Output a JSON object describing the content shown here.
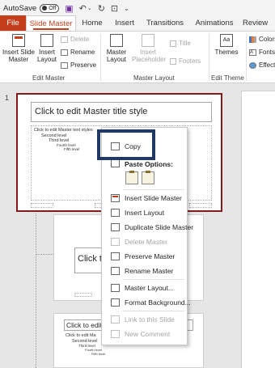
{
  "titlebar": {
    "autosave": "AutoSave",
    "toggle": "Off"
  },
  "tabs": [
    "File",
    "Slide Master",
    "Home",
    "Insert",
    "Transitions",
    "Animations",
    "Review"
  ],
  "ribbon": {
    "insert_slide_master": "Insert Slide Master",
    "insert_layout": "Insert Layout",
    "delete": "Delete",
    "rename": "Rename",
    "preserve": "Preserve",
    "group_edit_master": "Edit Master",
    "master_layout": "Master Layout",
    "insert_placeholder": "Insert Placeholder",
    "title": "Title",
    "footers": "Footers",
    "group_master_layout": "Master Layout",
    "themes": "Themes",
    "group_edit_theme": "Edit Theme",
    "colors": "Colors",
    "fonts": "Fonts",
    "effects": "Effects"
  },
  "pane": {
    "slide_number": "1",
    "master_title": "Click to edit Master title style",
    "master_levels": [
      "Click to edit Master text styles",
      "Second level",
      "Third level",
      "Fourth level",
      "Fifth level"
    ],
    "layout2_title": "Click to",
    "layout3_title": "Click to edit M",
    "layout3_levels": [
      "Click to edit Ma",
      "Second level",
      "Third level",
      "Fourth level",
      "Fifth level"
    ]
  },
  "context_menu": {
    "copy": "Copy",
    "paste_options": "Paste Options:",
    "insert_slide_master": "Insert Slide Master",
    "insert_layout": "Insert Layout",
    "duplicate_slide_master": "Duplicate Slide Master",
    "delete_master": "Delete Master",
    "preserve_master": "Preserve Master",
    "rename_master": "Rename Master",
    "master_layout": "Master Layout...",
    "format_background": "Format Background...",
    "link_to_slide": "Link to this Slide",
    "new_comment": "New Comment"
  },
  "colors": {
    "accent": "#c43e1c",
    "selected_border": "#7f1d1d",
    "highlight": "#1f3864"
  }
}
